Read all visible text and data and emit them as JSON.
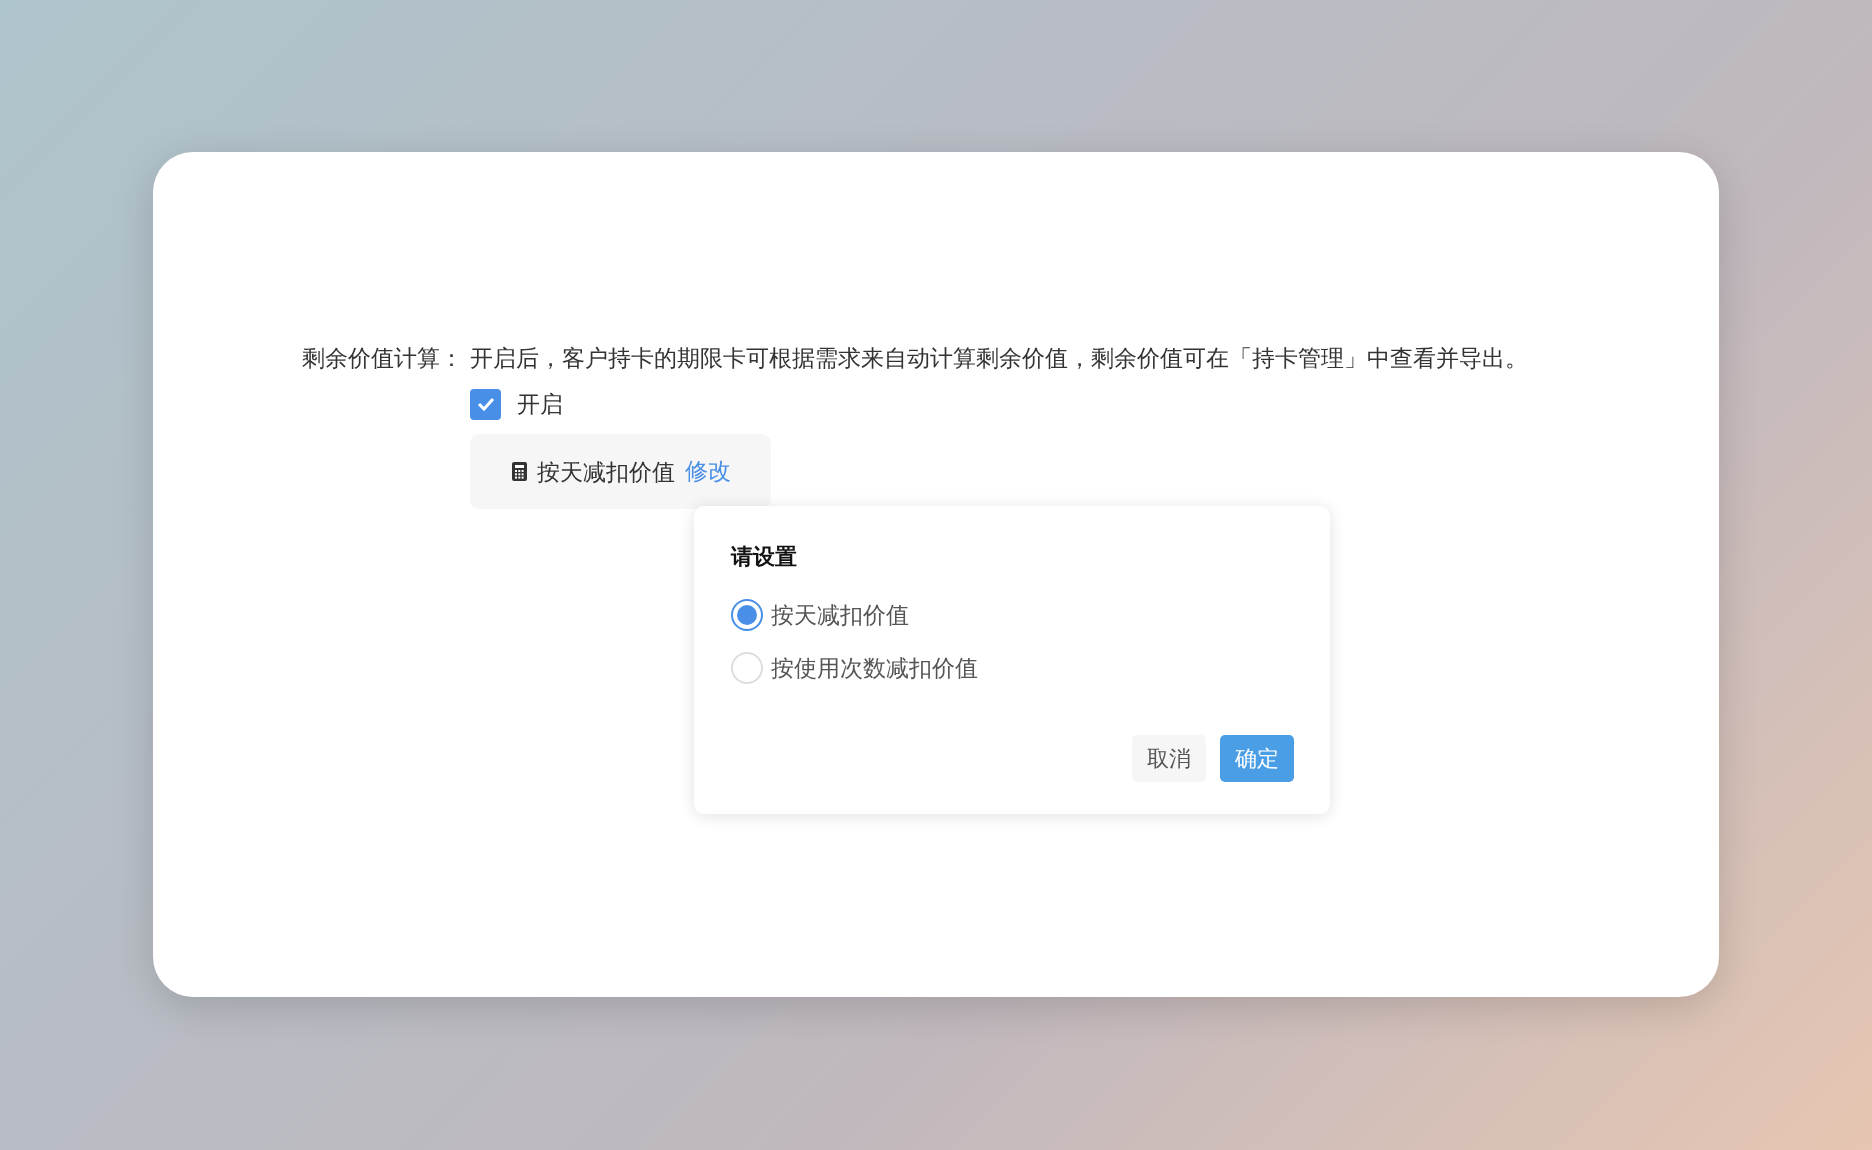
{
  "setting": {
    "label": "剩余价值计算：",
    "description": "开启后，客户持卡的期限卡可根据需求来自动计算剩余价值，剩余价值可在「持卡管理」中查看并导出。"
  },
  "enable": {
    "label": "开启",
    "checked": true
  },
  "method": {
    "value": "按天减扣价值",
    "edit_link": "修改"
  },
  "popover": {
    "title": "请设置",
    "options": [
      {
        "label": "按天减扣价值",
        "selected": true
      },
      {
        "label": "按使用次数减扣价值",
        "selected": false
      }
    ],
    "buttons": [
      {
        "label": "取消",
        "kind": "secondary"
      },
      {
        "label": "确定",
        "kind": "primary"
      }
    ]
  }
}
